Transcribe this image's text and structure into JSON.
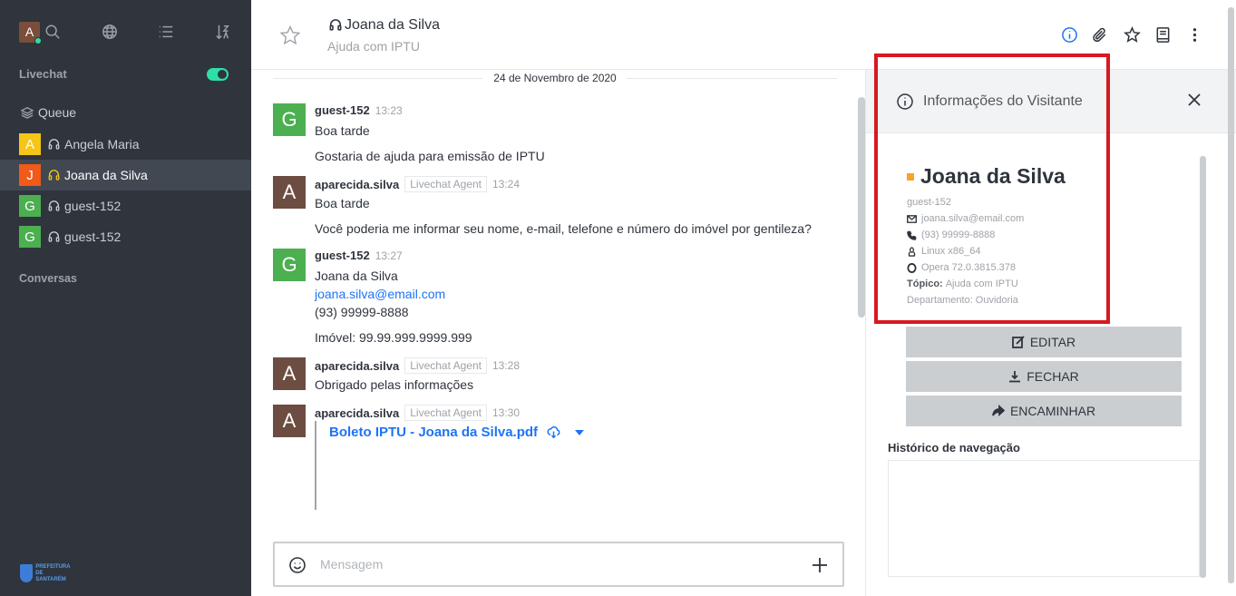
{
  "sidebar": {
    "user_initial": "A",
    "livechat_label": "Livechat",
    "queue_label": "Queue",
    "items": [
      {
        "initial": "A",
        "color": "#f5c518",
        "label": "Angela Maria"
      },
      {
        "initial": "J",
        "color": "#f05a1a",
        "label": "Joana da Silva"
      },
      {
        "initial": "G",
        "color": "#4caf50",
        "label": "guest-152"
      },
      {
        "initial": "G",
        "color": "#4caf50",
        "label": "guest-152"
      }
    ],
    "conversas_label": "Conversas",
    "logo_text": [
      "PREFEITURA DE",
      "SANTARÉM"
    ]
  },
  "header": {
    "title": "Joana da Silva",
    "subtitle": "Ajuda com IPTU"
  },
  "chat": {
    "date": "24 de Novembro de 2020",
    "messages": [
      {
        "initial": "G",
        "color": "#4caf50",
        "user": "guest-152",
        "role": "",
        "time": "13:23",
        "lines": [
          "Boa tarde",
          "Gostaria de ajuda para emissão de IPTU"
        ]
      },
      {
        "initial": "A",
        "color": "#6d4c41",
        "user": "aparecida.silva",
        "role": "Livechat Agent",
        "time": "13:24",
        "lines": [
          "Boa tarde",
          "Você poderia me informar seu nome, e-mail, telefone e número do imóvel por gentileza?"
        ]
      },
      {
        "initial": "G",
        "color": "#4caf50",
        "user": "guest-152",
        "role": "",
        "time": "13:27",
        "lines": [
          "Joana da Silva",
          "joana.silva@email.com",
          "(93) 99999-8888",
          "Imóvel: 99.99.999.9999.999"
        ]
      },
      {
        "initial": "A",
        "color": "#6d4c41",
        "user": "aparecida.silva",
        "role": "Livechat Agent",
        "time": "13:28",
        "lines": [
          "Obrigado pelas informações"
        ]
      },
      {
        "initial": "A",
        "color": "#6d4c41",
        "user": "aparecida.silva",
        "role": "Livechat Agent",
        "time": "13:30",
        "attachment": "Boleto IPTU - Joana da Silva.pdf"
      }
    ]
  },
  "composer": {
    "placeholder": "Mensagem"
  },
  "panel": {
    "title": "Informações do Visitante",
    "visitor_name": "Joana da Silva",
    "username": "guest-152",
    "email": "joana.silva@email.com",
    "phone": "(93) 99999-8888",
    "os": "Linux x86_64",
    "browser": "Opera 72.0.3815.378",
    "topic_label": "Tópico:",
    "topic_value": "Ajuda com IPTU",
    "department_label": "Departamento:",
    "department_value": "Ouvidoria",
    "buttons": {
      "edit": "EDITAR",
      "close": "FECHAR",
      "forward": "ENCAMINHAR"
    },
    "history_label": "Histórico de navegação"
  },
  "colors": {
    "sidebar_bg": "#2f343d",
    "accent": "#1d74f5",
    "highlight": "#d71921",
    "status_online": "#2de0a5",
    "visitor_status": "#f5a623"
  }
}
